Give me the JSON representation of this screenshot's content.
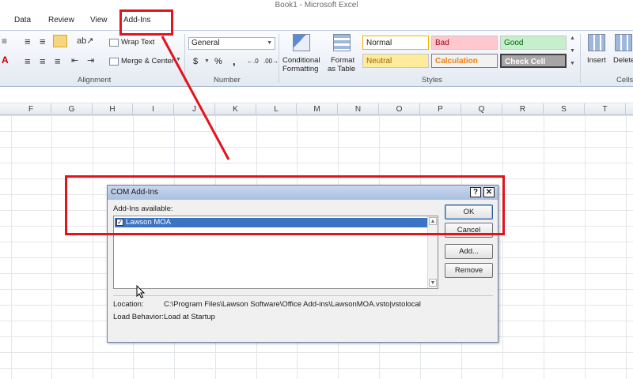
{
  "window": {
    "title": "Book1 - Microsoft Excel"
  },
  "tabs": [
    "Data",
    "Review",
    "View",
    "Add-Ins"
  ],
  "ribbon": {
    "alignment": {
      "wrap_text": "Wrap Text",
      "merge_center": "Merge & Center",
      "group_label": "Alignment"
    },
    "number": {
      "format": "General",
      "currency": "$",
      "percent": "%",
      "comma": ",",
      "group_label": "Number"
    },
    "styles": {
      "conditional_formatting": [
        "Conditional",
        "Formatting"
      ],
      "format_as_table": [
        "Format",
        "as Table"
      ],
      "cells": [
        "Normal",
        "Bad",
        "Good",
        "Neutral",
        "Calculation",
        "Check Cell"
      ],
      "group_label": "Styles"
    },
    "cells": {
      "insert": "Insert",
      "delete": "Delete",
      "group_label": "Cells"
    }
  },
  "columns": [
    "F",
    "G",
    "H",
    "I",
    "J",
    "K",
    "L",
    "M",
    "N",
    "O",
    "P",
    "Q",
    "R",
    "S",
    "T"
  ],
  "dialog": {
    "title": "COM Add-Ins",
    "help": "?",
    "close": "✕",
    "available_label": "Add-Ins available:",
    "items": [
      {
        "name": "Lawson MOA",
        "checked": true
      }
    ],
    "location_label": "Location:",
    "location_value": "C:\\Program Files\\Lawson Software\\Office Add-ins\\LawsonMOA.vsto|vstolocal",
    "load_behavior_label": "Load Behavior:",
    "load_behavior_value": "Load at Startup",
    "buttons": {
      "ok": "OK",
      "cancel": "Cancel",
      "add": "Add...",
      "remove": "Remove"
    }
  },
  "colors": {
    "annotation_red": "#e3121b",
    "style_bad_bg": "#ffc7ce",
    "style_good_bg": "#c6efce",
    "style_neutral_bg": "#ffeb9c",
    "style_calc_fg": "#fa7d00",
    "style_check_bg": "#a5a5a5",
    "selection_blue": "#3b73c5"
  }
}
